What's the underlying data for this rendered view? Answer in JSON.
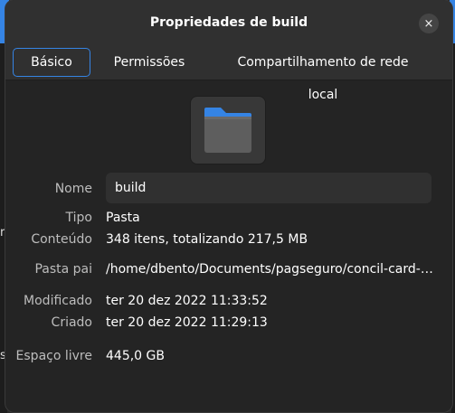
{
  "window": {
    "title": "Propriedades de build",
    "close_icon": "×"
  },
  "tabs": [
    {
      "label": "Básico",
      "active": true
    },
    {
      "label": "Permissões",
      "active": false
    },
    {
      "label": "Compartilhamento de rede local",
      "active": false
    }
  ],
  "folder_icon": {
    "name": "folder-icon",
    "tab_color": "#3584e4",
    "body_color": "#5e5e5e"
  },
  "properties": {
    "name_label": "Nome",
    "name_value": "build",
    "type_label": "Tipo",
    "type_value": "Pasta",
    "contents_label": "Conteúdo",
    "contents_value": "348 itens, totalizando 217,5 MB",
    "parent_label": "Pasta pai",
    "parent_value": "/home/dbento/Documents/pagseguro/concil-card-…",
    "modified_label": "Modificado",
    "modified_value": "ter 20 dez 2022 11:33:52",
    "created_label": "Criado",
    "created_value": "ter 20 dez 2022 11:29:13",
    "free_space_label": "Espaço livre",
    "free_space_value": "445,0 GB"
  },
  "background": {
    "glyph_1": "r",
    "glyph_2": "s"
  },
  "colors": {
    "accent": "#3584e4",
    "dialog_bg": "#242424",
    "header_bg": "#303030",
    "label_text": "#bdbdbd"
  }
}
